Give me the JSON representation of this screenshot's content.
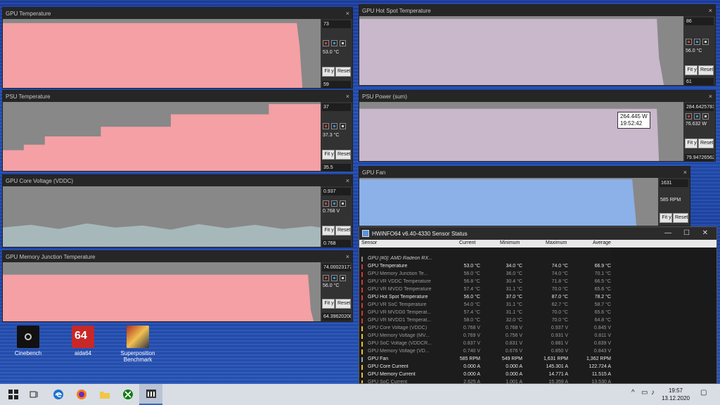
{
  "desktop": {
    "icons": [
      {
        "label": "Cinebench",
        "icon": "cinebench-icon"
      },
      {
        "label": "aida64",
        "icon": "aida64-icon"
      },
      {
        "label": "Superposition\nBenchmark",
        "icon": "superposition-icon"
      }
    ]
  },
  "graphs": [
    {
      "title": "GPU Temperature",
      "max": "73",
      "current": "53.0 °C",
      "min": "59",
      "fit": "Fit y",
      "reset": "Reset",
      "color": "#f4a0a4",
      "level": 0.96
    },
    {
      "title": "GPU Hot Spot Temperature",
      "max": "86",
      "current": "56.0 °C",
      "min": "61",
      "fit": "Fit y",
      "reset": "Reset",
      "color": "#c9b7cb",
      "level": 0.96
    },
    {
      "title": "PSU Temperature",
      "max": "37",
      "current": "37.3 °C",
      "min": "35.5",
      "fit": "Fit y",
      "reset": "Reset",
      "color": "#f4a0a4",
      "level": 0.7
    },
    {
      "title": "PSU Power (sum)",
      "max": "284.6425781",
      "current": "76.632 W",
      "min": "79.94726562",
      "fit": "Fit y",
      "reset": "Reset",
      "color": "#c9b7cb",
      "level": 0.85,
      "tooltip_value": "264.445 W",
      "tooltip_time": "19:52:42"
    },
    {
      "title": "GPU Core Voltage (VDDC)",
      "max": "0.937",
      "current": "0.768 V",
      "min": "0.768",
      "fit": "Fit y",
      "reset": "Reset",
      "color": "#a7b8bb",
      "level": 0.35
    },
    {
      "title": "GPU Fan",
      "max": "1631",
      "current": "585 RPM",
      "min": "",
      "fit": "Fit y",
      "reset": "Reset",
      "color": "#8cb0e8",
      "level": 0.9
    },
    {
      "title": "GPU Memory Junction Temperature",
      "max": "74.00023177",
      "current": "56.0 °C",
      "min": "64.39620208",
      "fit": "Fit y",
      "reset": "Reset",
      "color": "#f4a0a4",
      "level": 0.96
    }
  ],
  "hwinfo": {
    "title": "HWiNFO64 v6.40-4330 Sensor Status",
    "columns": [
      "Sensor",
      "Current",
      "Minimum",
      "Maximum",
      "Average"
    ],
    "group": "GPU [#0]: AMD Radeon RX...",
    "rows": [
      {
        "name": "GPU Temperature",
        "cur": "53.0 °C",
        "min": "34.0 °C",
        "max": "74.0 °C",
        "avg": "66.9 °C",
        "icon": "temp",
        "dim": false
      },
      {
        "name": "GPU Memory Junction Te...",
        "cur": "56.0 °C",
        "min": "36.0 °C",
        "max": "74.0 °C",
        "avg": "70.1 °C",
        "icon": "temp",
        "dim": true
      },
      {
        "name": "GPU VR VDDC Temperature",
        "cur": "56.8 °C",
        "min": "30.4 °C",
        "max": "71.8 °C",
        "avg": "66.5 °C",
        "icon": "temp",
        "dim": true
      },
      {
        "name": "GPU VR MVDD Temperature",
        "cur": "57.4 °C",
        "min": "31.1 °C",
        "max": "70.0 °C",
        "avg": "65.6 °C",
        "icon": "temp",
        "dim": true
      },
      {
        "name": "GPU Hot Spot Temperature",
        "cur": "56.0 °C",
        "min": "37.0 °C",
        "max": "87.0 °C",
        "avg": "78.2 °C",
        "icon": "temp",
        "dim": false
      },
      {
        "name": "GPU VR SoC Temperature",
        "cur": "54.0 °C",
        "min": "31.1 °C",
        "max": "62.7 °C",
        "avg": "58.7 °C",
        "icon": "temp",
        "dim": true
      },
      {
        "name": "GPU VR MVDD0 Temperat...",
        "cur": "57.4 °C",
        "min": "31.1 °C",
        "max": "70.0 °C",
        "avg": "65.6 °C",
        "icon": "temp",
        "dim": true
      },
      {
        "name": "GPU VR MVDD1 Temperat...",
        "cur": "58.0 °C",
        "min": "32.0 °C",
        "max": "70.0 °C",
        "avg": "64.8 °C",
        "icon": "temp",
        "dim": true
      },
      {
        "name": "GPU Core Voltage (VDDC)",
        "cur": "0.768 V",
        "min": "0.768 V",
        "max": "0.937 V",
        "avg": "0.845 V",
        "icon": "volt",
        "dim": true
      },
      {
        "name": "GPU Memory Voltage (MV...",
        "cur": "0.769 V",
        "min": "0.756 V",
        "max": "0.931 V",
        "avg": "0.811 V",
        "icon": "volt",
        "dim": true
      },
      {
        "name": "GPU SoC Voltage (VDDCR...",
        "cur": "0.837 V",
        "min": "0.831 V",
        "max": "0.881 V",
        "avg": "0.839 V",
        "icon": "volt",
        "dim": true
      },
      {
        "name": "GPU Memory Voltage (VD...",
        "cur": "0.740 V",
        "min": "0.676 V",
        "max": "0.850 V",
        "avg": "0.843 V",
        "icon": "volt",
        "dim": true
      },
      {
        "name": "GPU Fan",
        "cur": "585 RPM",
        "min": "549 RPM",
        "max": "1,631 RPM",
        "avg": "1,362 RPM",
        "icon": "fan",
        "dim": false
      },
      {
        "name": "GPU Core Current",
        "cur": "0.000 A",
        "min": "0.000 A",
        "max": "145.301 A",
        "avg": "122.724 A",
        "icon": "volt",
        "dim": false
      },
      {
        "name": "GPU Memory Current",
        "cur": "0.000 A",
        "min": "0.000 A",
        "max": "14.771 A",
        "avg": "11.515 A",
        "icon": "volt",
        "dim": false
      },
      {
        "name": "GPU SoC Current",
        "cur": "2.625 A",
        "min": "1.001 A",
        "max": "15.359 A",
        "avg": "13.530 A",
        "icon": "volt",
        "dim": true
      }
    ]
  },
  "taskbar": {
    "time": "19:57",
    "date": "13.12.2020",
    "accent": "#3366cc"
  }
}
